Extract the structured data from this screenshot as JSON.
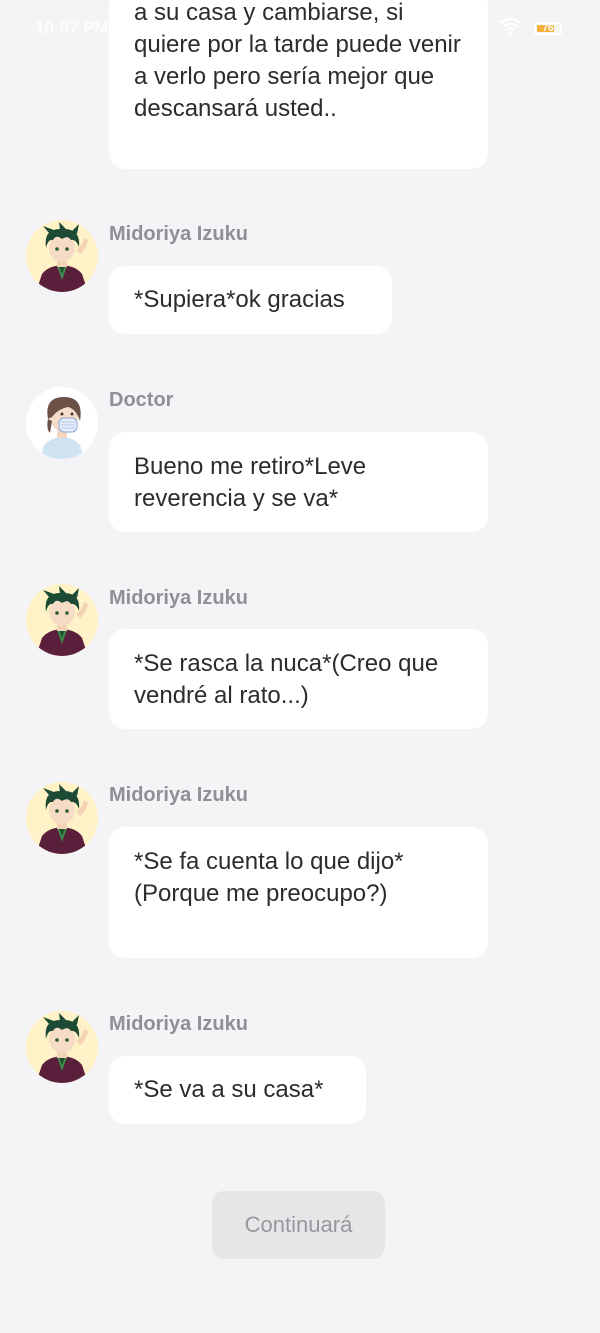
{
  "status_bar": {
    "time": "10:07 PM",
    "battery": "76"
  },
  "messages": [
    {
      "text": "a su casa y cambiarse, si quiere por la tarde puede venir a verlo pero sería mejor que descansará usted.."
    },
    {
      "sender": "Midoriya Izuku",
      "text": "*Supiera*ok gracias"
    },
    {
      "sender": "Doctor",
      "text": "Bueno me retiro*Leve reverencia y se va*"
    },
    {
      "sender": "Midoriya Izuku",
      "text": "*Se rasca la nuca*(Creo que vendré al rato...)"
    },
    {
      "sender": "Midoriya Izuku",
      "text": "*Se fa cuenta lo que dijo*(Porque me preocupo?)"
    },
    {
      "sender": "Midoriya Izuku",
      "text": "*Se va a su casa*"
    }
  ],
  "continue_label": "Continuará"
}
